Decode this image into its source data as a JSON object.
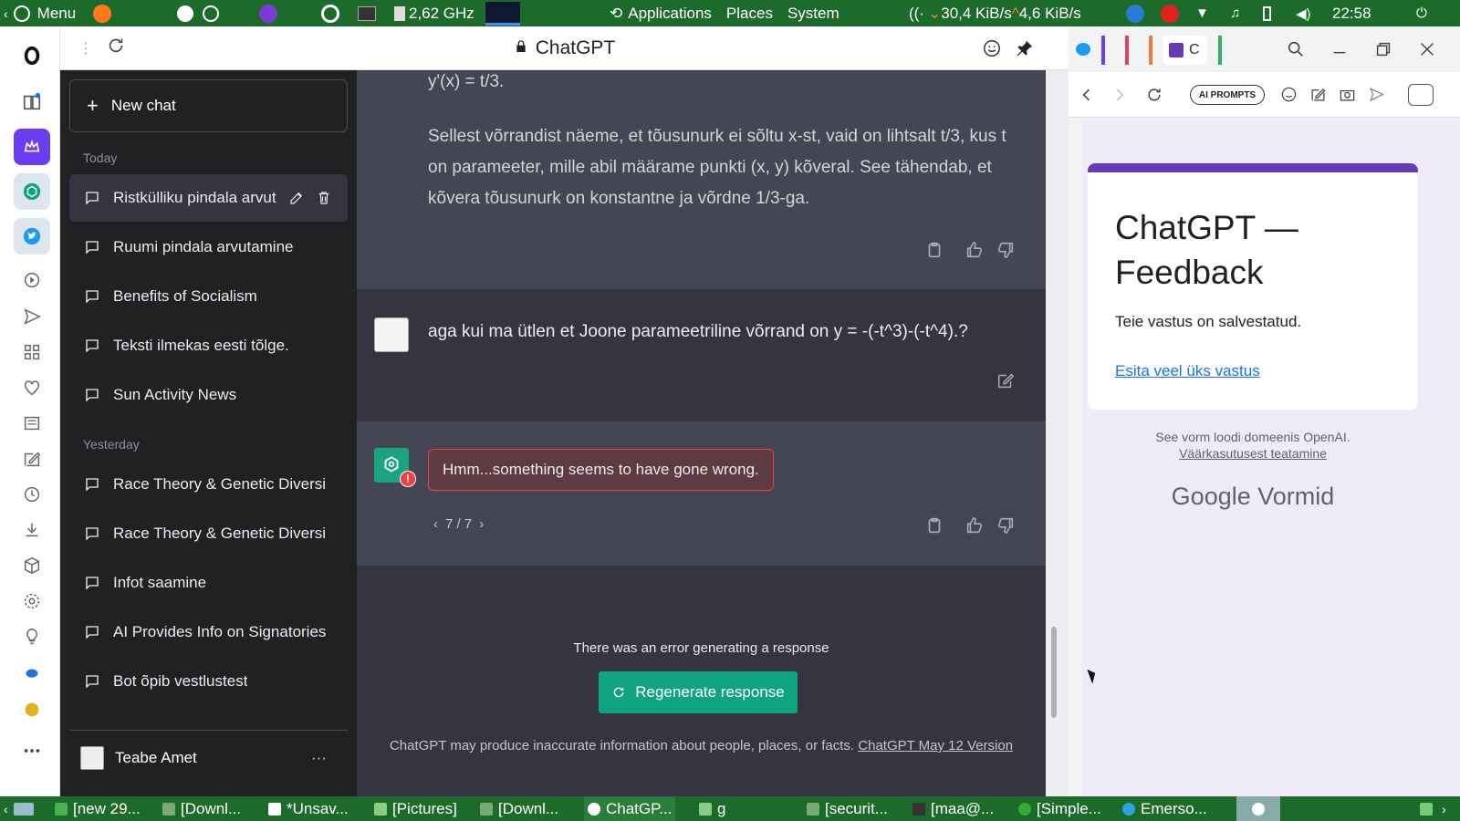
{
  "top_panel": {
    "menu_label": "Menu",
    "cpu_freq": "2,62 GHz",
    "menu_items": [
      "Applications",
      "Places",
      "System"
    ],
    "net_down": "30,4 KiB/s",
    "net_up": "4,6 KiB/s",
    "clock": "22:58"
  },
  "browser": {
    "page_title": "ChatGPT"
  },
  "chat_sidebar": {
    "new_chat_label": "New chat",
    "sections": [
      {
        "label": "Today",
        "items": [
          "Ristkülliku pindala arvut",
          "Ruumi pindala arvutamine",
          "Benefits of Socialism",
          "Teksti ilmekas eesti tõlge.",
          "Sun Activity News"
        ]
      },
      {
        "label": "Yesterday",
        "items": [
          "Race Theory & Genetic Diversi",
          "Race Theory & Genetic Diversi",
          "Infot saamine",
          "AI Provides Info on Signatories",
          "Bot õpib vestlustest"
        ]
      }
    ],
    "user_name": "Teabe Amet",
    "user_menu": "···"
  },
  "conversation": {
    "prev_tail": "y'(x) = t/3.",
    "prev_paragraph": "Sellest võrrandist näeme, et tõusunurk ei sõltu x-st, vaid on lihtsalt t/3, kus t on parameeter, mille abil määrame punkti (x, y) kõveral. See tähendab, et kõvera tõusunurk on konstantne ja võrdne 1/3-ga.",
    "user_message": "aga kui ma ütlen et Joone parameetriline võrrand on y = -(-t^3)-(-t^4).?",
    "error_message": "Hmm...something seems to have gone wrong.",
    "pagination": "7 / 7",
    "error_notice": "There was an error generating a response",
    "regenerate_label": "Regenerate response",
    "disclaimer": "ChatGPT may produce inaccurate information about people, places, or facts.",
    "version_link": "ChatGPT May 12 Version"
  },
  "right_panel": {
    "ai_prompts_label": "AI PROMPTS",
    "tab_label": "C",
    "form_title": "ChatGPT — Feedback",
    "form_saved": "Teie vastus on salvestatud.",
    "form_link": "Esita veel üks vastus",
    "form_domain": "See vorm loodi domeenis OpenAI.",
    "form_abuse": "Väärkasutusest teatamine",
    "google_brand": "Google",
    "forms_brand": "Vormid",
    "accent": "#673ab7"
  },
  "taskbar": {
    "items": [
      "[new 29...",
      "[Downl...",
      "*Unsav...",
      "[Pictures]",
      "[Downl...",
      "ChatGP...",
      "g",
      "[securit...",
      "[maa@...",
      "[Simple...",
      "Emerso..."
    ]
  },
  "colors": {
    "panel_green": "#1d6b2a",
    "chatgpt_green": "#10a37f",
    "sidebar_bg": "#202123",
    "chat_bg": "#343541",
    "ai_bg": "#444654"
  }
}
